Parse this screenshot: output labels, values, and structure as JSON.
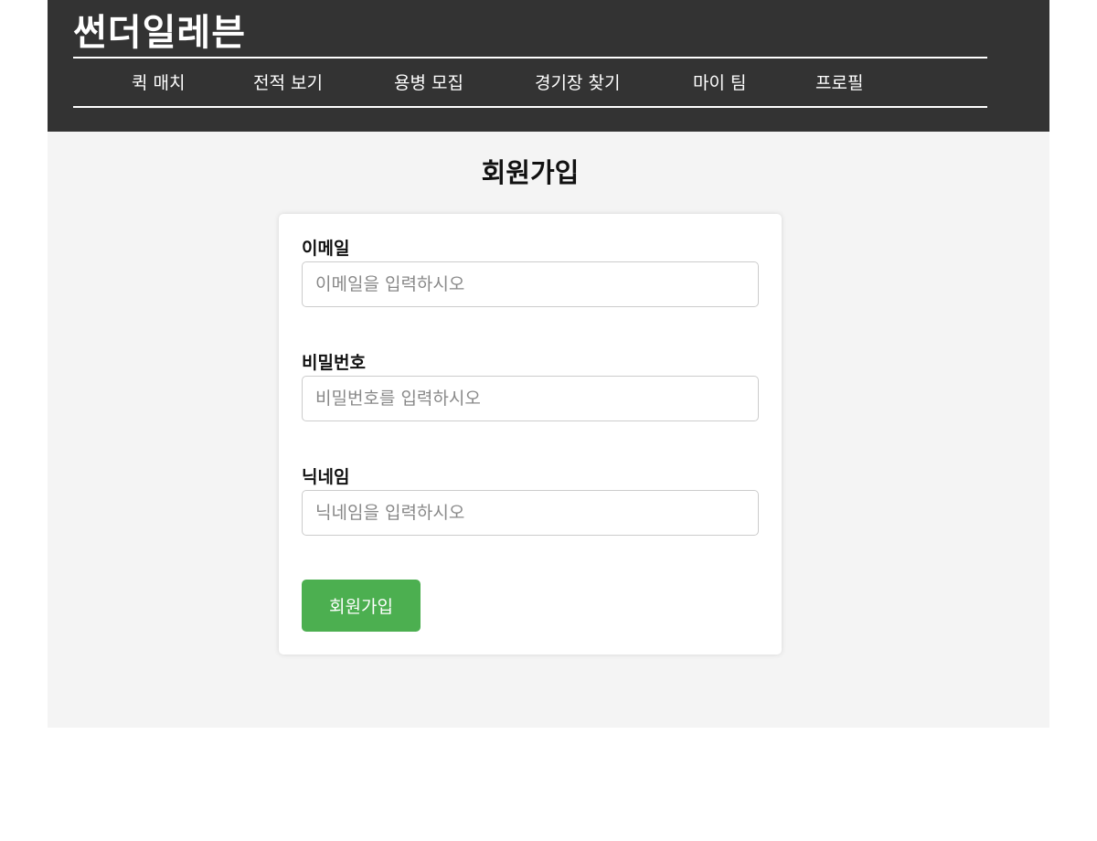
{
  "header": {
    "logo": "썬더일레븐",
    "nav": [
      {
        "label": "퀵 매치"
      },
      {
        "label": "전적 보기"
      },
      {
        "label": "용병 모집"
      },
      {
        "label": "경기장 찾기"
      },
      {
        "label": "마이 팀"
      },
      {
        "label": "프로필"
      }
    ]
  },
  "main": {
    "title": "회원가입",
    "form": {
      "email": {
        "label": "이메일",
        "placeholder": "이메일을 입력하시오",
        "value": ""
      },
      "password": {
        "label": "비밀번호",
        "placeholder": "비밀번호를 입력하시오",
        "value": ""
      },
      "nickname": {
        "label": "닉네임",
        "placeholder": "닉네임을 입력하시오",
        "value": ""
      },
      "submit_label": "회원가입"
    }
  },
  "colors": {
    "header_bg": "#333333",
    "page_bg": "#f4f4f4",
    "button_bg": "#4caf50"
  }
}
